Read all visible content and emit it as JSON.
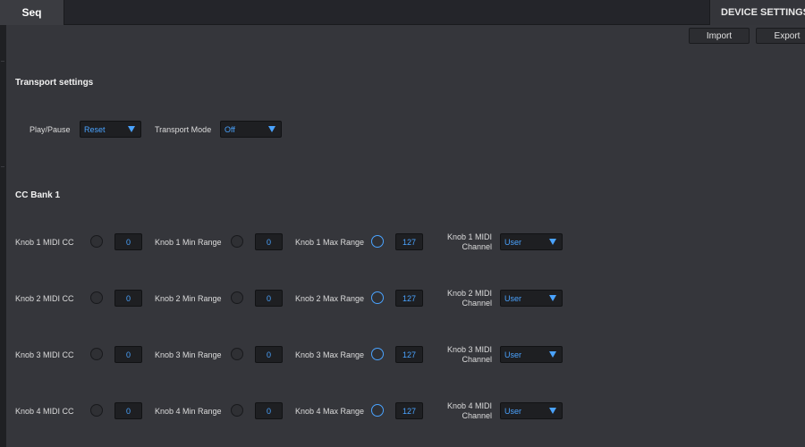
{
  "tabs": {
    "seq": "Seq",
    "device_settings": "DEVICE SETTINGS"
  },
  "toolbar": {
    "import_label": "Import",
    "export_label": "Export"
  },
  "transport": {
    "title": "Transport settings",
    "play_pause_label": "Play/Pause",
    "play_pause_value": "Reset",
    "transport_mode_label": "Transport Mode",
    "transport_mode_value": "Off"
  },
  "cc_bank": {
    "title": "CC Bank 1",
    "knobs": [
      {
        "cc_label": "Knob 1 MIDI CC",
        "cc_value": "0",
        "min_label": "Knob 1 Min Range",
        "min_value": "0",
        "max_label": "Knob 1 Max Range",
        "max_value": "127",
        "channel_label": "Knob 1 MIDI Channel",
        "channel_value": "User"
      },
      {
        "cc_label": "Knob 2 MIDI CC",
        "cc_value": "0",
        "min_label": "Knob 2 Min Range",
        "min_value": "0",
        "max_label": "Knob 2 Max Range",
        "max_value": "127",
        "channel_label": "Knob 2 MIDI Channel",
        "channel_value": "User"
      },
      {
        "cc_label": "Knob 3 MIDI CC",
        "cc_value": "0",
        "min_label": "Knob 3 Min Range",
        "min_value": "0",
        "max_label": "Knob 3 Max Range",
        "max_value": "127",
        "channel_label": "Knob 3 MIDI Channel",
        "channel_value": "User"
      },
      {
        "cc_label": "Knob 4 MIDI CC",
        "cc_value": "0",
        "min_label": "Knob 4 Min Range",
        "min_value": "0",
        "max_label": "Knob 4 Max Range",
        "max_value": "127",
        "channel_label": "Knob 4 MIDI Channel",
        "channel_value": "User"
      }
    ]
  },
  "colors": {
    "accent": "#4aa3ff",
    "panel": "#35363b",
    "field": "#1e1f22"
  }
}
